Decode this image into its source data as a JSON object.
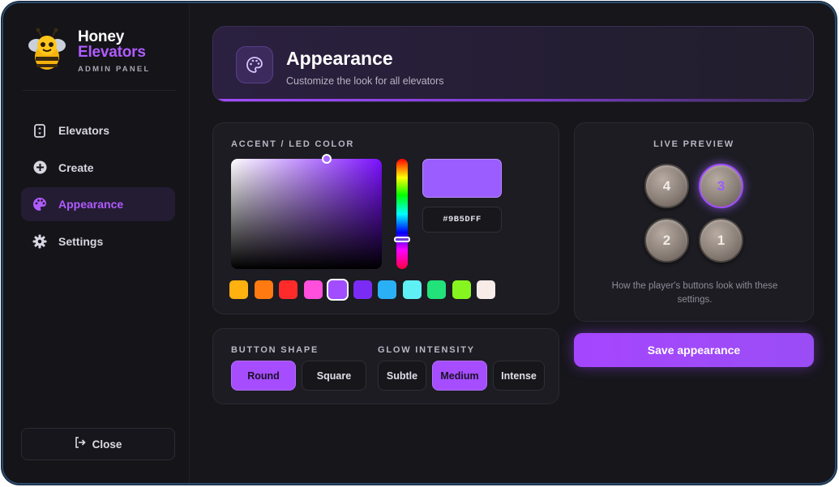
{
  "brand": {
    "name_line1": "Honey",
    "name_line2": "Elevators",
    "subtitle": "ADMIN PANEL"
  },
  "sidebar": {
    "items": [
      {
        "label": "Elevators",
        "icon": "elevator-icon",
        "active": false
      },
      {
        "label": "Create",
        "icon": "plus-circle-icon",
        "active": false
      },
      {
        "label": "Appearance",
        "icon": "palette-icon",
        "active": true
      },
      {
        "label": "Settings",
        "icon": "gear-icon",
        "active": false
      }
    ],
    "close_label": "Close"
  },
  "header": {
    "title": "Appearance",
    "subtitle": "Customize the look for all elevators"
  },
  "color": {
    "section_title": "ACCENT / LED COLOR",
    "hex_value": "#9B5DFF",
    "current_color": "#9b5dff",
    "swatches": [
      "#ffb10f",
      "#ff7a10",
      "#ff2a2a",
      "#ff4fdc",
      "#a24dff",
      "#7a2cf5",
      "#2ab0f5",
      "#5ff0f5",
      "#22e27a",
      "#86f51f",
      "#f7ece8"
    ],
    "selected_swatch_index": 4
  },
  "options": {
    "shape_title": "BUTTON SHAPE",
    "shape_buttons": [
      {
        "label": "Round",
        "active": true
      },
      {
        "label": "Square",
        "active": false
      }
    ],
    "glow_title": "GLOW INTENSITY",
    "glow_buttons": [
      {
        "label": "Subtle",
        "active": false
      },
      {
        "label": "Medium",
        "active": true
      },
      {
        "label": "Intense",
        "active": false
      }
    ]
  },
  "preview": {
    "section_title": "LIVE PREVIEW",
    "buttons": [
      "4",
      "3",
      "2",
      "1"
    ],
    "lit_button": "3",
    "note": "How the player's buttons look with these settings."
  },
  "save_label": "Save appearance"
}
